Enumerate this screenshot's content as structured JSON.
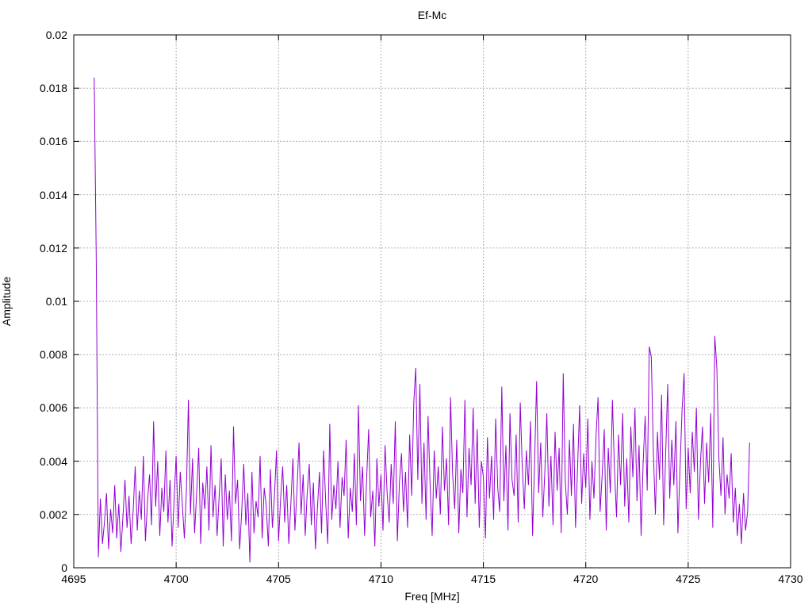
{
  "chart_data": {
    "type": "line",
    "title": "Ef-Mc",
    "xlabel": "Freq [MHz]",
    "ylabel": "Amplitude",
    "xlim": [
      4695,
      4730
    ],
    "ylim": [
      0,
      0.02
    ],
    "xticks": [
      4695,
      4700,
      4705,
      4710,
      4715,
      4720,
      4725,
      4730
    ],
    "xtick_labels": [
      "4695",
      "4700",
      "4705",
      "4710",
      "4715",
      "4720",
      "4725",
      "4730"
    ],
    "yticks": [
      0,
      0.002,
      0.004,
      0.006,
      0.008,
      0.01,
      0.012,
      0.014,
      0.016,
      0.018,
      0.02
    ],
    "ytick_labels": [
      "0",
      "0.002",
      "0.004",
      "0.006",
      "0.008",
      "0.01",
      "0.012",
      "0.014",
      "0.016",
      "0.018",
      "0.02"
    ],
    "grid": true,
    "legend": "none",
    "line_color": "#9400d3",
    "grid_color": "#b0b0b0",
    "axis_color": "#000000",
    "series": [
      {
        "name": "Ef-Mc",
        "x_start": 4696.0,
        "x_step": 0.1,
        "value_scale": 0.0001,
        "values": [
          184,
          115,
          4,
          26,
          9,
          17,
          28,
          7,
          22,
          13,
          31,
          11,
          24,
          6,
          19,
          33,
          15,
          27,
          9,
          21,
          38,
          14,
          29,
          18,
          42,
          10,
          25,
          35,
          16,
          55,
          23,
          40,
          12,
          30,
          21,
          44,
          17,
          33,
          8,
          26,
          42,
          15,
          36,
          24,
          11,
          29,
          63,
          20,
          41,
          13,
          28,
          45,
          9,
          32,
          22,
          38,
          14,
          46,
          19,
          31,
          12,
          27,
          41,
          8,
          35,
          18,
          29,
          10,
          53,
          24,
          33,
          7,
          21,
          39,
          16,
          28,
          2,
          36,
          13,
          25,
          19,
          42,
          11,
          30,
          23,
          8,
          37,
          15,
          27,
          44,
          10,
          26,
          38,
          17,
          31,
          9,
          24,
          41,
          14,
          29,
          47,
          20,
          35,
          12,
          28,
          39,
          16,
          32,
          7,
          23,
          36,
          13,
          44,
          25,
          9,
          54,
          18,
          31,
          22,
          40,
          15,
          34,
          27,
          48,
          11,
          30,
          21,
          43,
          16,
          61,
          25,
          38,
          12,
          33,
          52,
          19,
          29,
          8,
          41,
          23,
          35,
          14,
          46,
          28,
          17,
          39,
          24,
          55,
          10,
          32,
          43,
          21,
          36,
          15,
          50,
          27,
          62,
          75,
          33,
          69,
          24,
          47,
          18,
          57,
          31,
          12,
          44,
          26,
          38,
          20,
          53,
          29,
          41,
          16,
          64,
          35,
          22,
          48,
          13,
          37,
          28,
          63,
          19,
          45,
          31,
          60,
          24,
          52,
          15,
          40,
          34,
          11,
          49,
          26,
          42,
          18,
          56,
          30,
          21,
          68,
          25,
          46,
          14,
          58,
          33,
          27,
          50,
          17,
          62,
          38,
          22,
          44,
          31,
          55,
          12,
          39,
          70,
          28,
          47,
          19,
          36,
          58,
          23,
          42,
          16,
          51,
          29,
          45,
          13,
          73,
          32,
          20,
          48,
          27,
          54,
          15,
          38,
          61,
          24,
          43,
          30,
          56,
          18,
          40,
          26,
          49,
          64,
          21,
          35,
          52,
          14,
          45,
          28,
          63,
          37,
          19,
          50,
          31,
          58,
          23,
          41,
          17,
          53,
          34,
          60,
          25,
          46,
          12,
          39,
          57,
          29,
          83,
          79,
          44,
          20,
          51,
          33,
          65,
          16,
          42,
          69,
          26,
          48,
          31,
          55,
          13,
          37,
          59,
          73,
          22,
          45,
          28,
          51,
          36,
          60,
          18,
          40,
          53,
          24,
          47,
          32,
          58,
          15,
          87,
          75,
          41,
          27,
          49,
          20,
          35,
          26,
          43,
          17,
          30,
          12,
          24,
          9,
          28,
          14,
          21,
          47
        ]
      }
    ]
  }
}
